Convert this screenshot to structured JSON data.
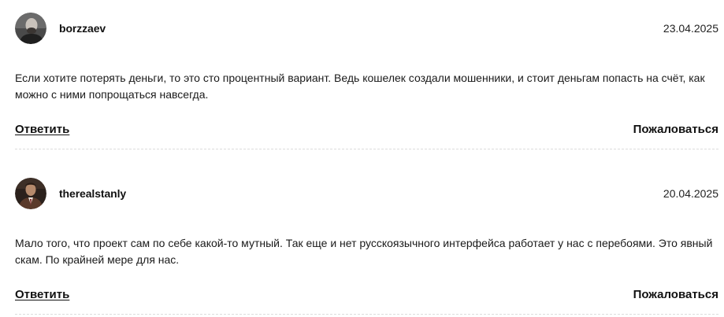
{
  "comments": [
    {
      "username": "borzzaev",
      "date": "23.04.2025",
      "text": "Если хотите потерять деньги, то это сто процентный вариант. Ведь кошелек создали мошенники, и стоит деньгам попасть на счёт, как можно с ними попрощаться навсегда.",
      "reply_label": "Ответить",
      "report_label": "Пожаловаться"
    },
    {
      "username": "therealstanly",
      "date": "20.04.2025",
      "text": "Мало того, что проект сам по себе какой-то мутный. Так еще и нет русскоязычного интерфейса работает у нас с перебоями. Это явный скам. По крайней мере для нас.",
      "reply_label": "Ответить",
      "report_label": "Пожаловаться"
    }
  ]
}
